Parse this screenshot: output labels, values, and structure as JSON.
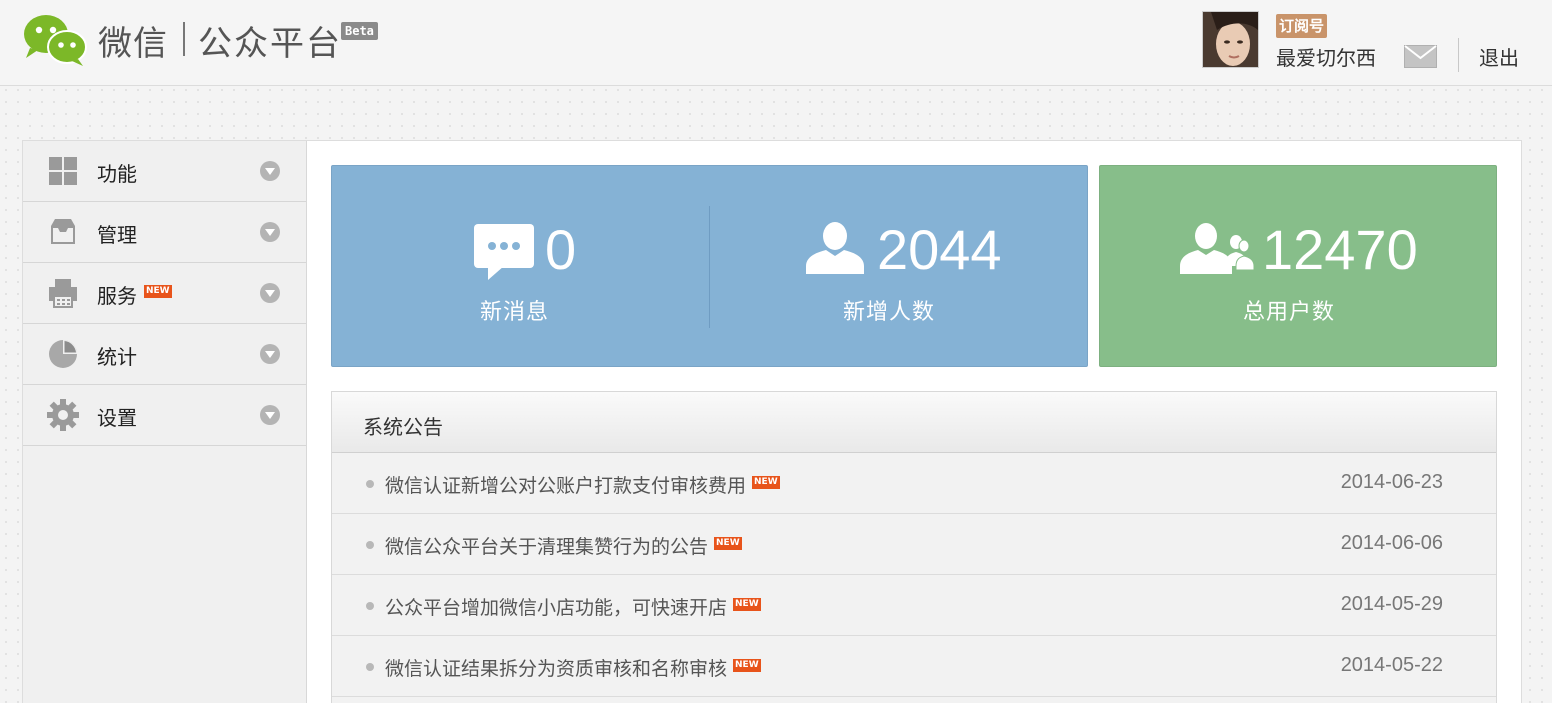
{
  "header": {
    "logo_text": "微信",
    "logo_sub": "公众平台",
    "beta_label": "Beta",
    "account_type": "订阅号",
    "account_name": "最爱切尔西",
    "logout_label": "退出"
  },
  "sidebar": {
    "items": [
      {
        "label": "功能",
        "icon": "grid-icon"
      },
      {
        "label": "管理",
        "icon": "inbox-icon"
      },
      {
        "label": "服务",
        "icon": "printer-icon",
        "badge": "NEW"
      },
      {
        "label": "统计",
        "icon": "pie-chart-icon"
      },
      {
        "label": "设置",
        "icon": "gear-icon"
      }
    ]
  },
  "stats": {
    "messages": {
      "value": "0",
      "label": "新消息",
      "icon": "chat-bubble-icon"
    },
    "new_users": {
      "value": "2044",
      "label": "新增人数",
      "icon": "user-icon"
    },
    "total_users": {
      "value": "12470",
      "label": "总用户数",
      "icon": "users-group-icon"
    }
  },
  "notice": {
    "title": "系统公告",
    "items": [
      {
        "text": "微信认证新增公对公账户打款支付审核费用",
        "badge": "NEW",
        "date": "2014-06-23"
      },
      {
        "text": "微信公众平台关于清理集赞行为的公告",
        "badge": "NEW",
        "date": "2014-06-06"
      },
      {
        "text": "公众平台增加微信小店功能，可快速开店",
        "badge": "NEW",
        "date": "2014-05-29"
      },
      {
        "text": "微信认证结果拆分为资质审核和名称审核",
        "badge": "NEW",
        "date": "2014-05-22"
      }
    ]
  },
  "colors": {
    "blue_card": "#85b2d5",
    "green_card": "#87be8a",
    "new_badge": "#e8541b",
    "wechat_green": "#7cb828"
  }
}
